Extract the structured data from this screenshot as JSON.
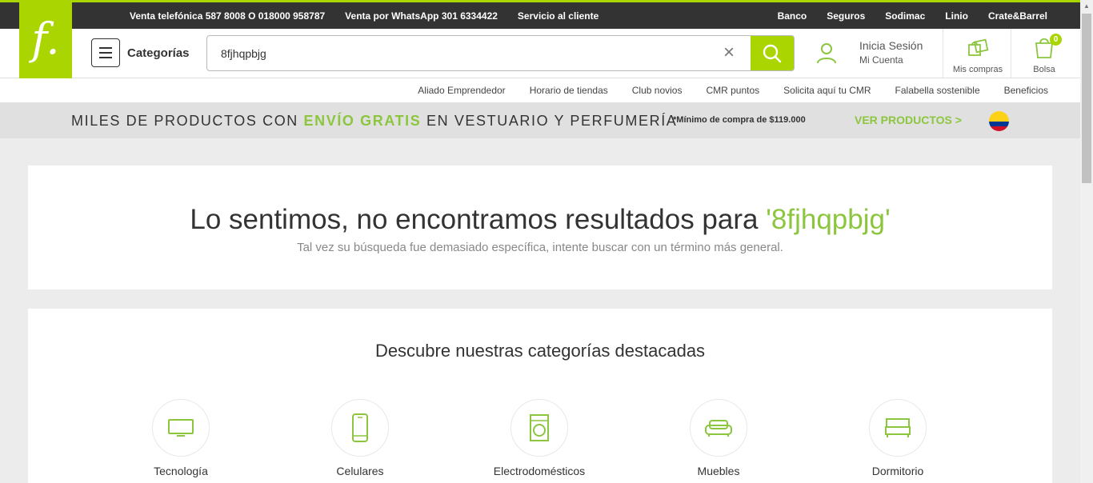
{
  "topbar": {
    "left_links": [
      "Venta telefónica 587 8008 O 018000 958787",
      "Venta por WhatsApp 301 6334422",
      "Servicio al cliente"
    ],
    "right_links": [
      "Banco",
      "Seguros",
      "Sodimac",
      "Linio",
      "Crate&Barrel"
    ]
  },
  "logo": {
    "text": "f."
  },
  "header": {
    "categories_label": "Categorías",
    "search_value": "8fjhqpbjg",
    "login_line1": "Inicia Sesión",
    "login_line2": "Mi Cuenta",
    "mis_compras": "Mis compras",
    "bolsa": "Bolsa",
    "bolsa_count": "0"
  },
  "subnav": [
    "Aliado Emprendedor",
    "Horario de tiendas",
    "Club novios",
    "CMR puntos",
    "Solicita aquí tu CMR",
    "Falabella sostenible",
    "Beneficios"
  ],
  "promo": {
    "part1": "MILES DE PRODUCTOS CON ",
    "highlight": "ENVÍO GRATIS",
    "part2": " EN VESTUARIO Y PERFUMERÍA",
    "minimum": "*Mínimo de compra de $119.000",
    "cta": "VER PRODUCTOS >"
  },
  "no_results": {
    "title_prefix": "Lo sentimos, no encontramos resultados para ",
    "query": "'8fjhqpbjg'",
    "subtitle": "Tal vez su búsqueda fue demasiado específica, intente buscar con un término más general."
  },
  "featured": {
    "title": "Descubre nuestras categorías destacadas",
    "categories": [
      {
        "name": "Tecnología",
        "icon": "tv-icon"
      },
      {
        "name": "Celulares",
        "icon": "phone-icon"
      },
      {
        "name": "Electrodomésticos",
        "icon": "washer-icon"
      },
      {
        "name": "Muebles",
        "icon": "sofa-icon"
      },
      {
        "name": "Dormitorio",
        "icon": "bed-icon"
      }
    ]
  },
  "colors": {
    "brand_green": "#aad500",
    "text_green": "#8cc63f",
    "topbar_bg": "#333333"
  }
}
